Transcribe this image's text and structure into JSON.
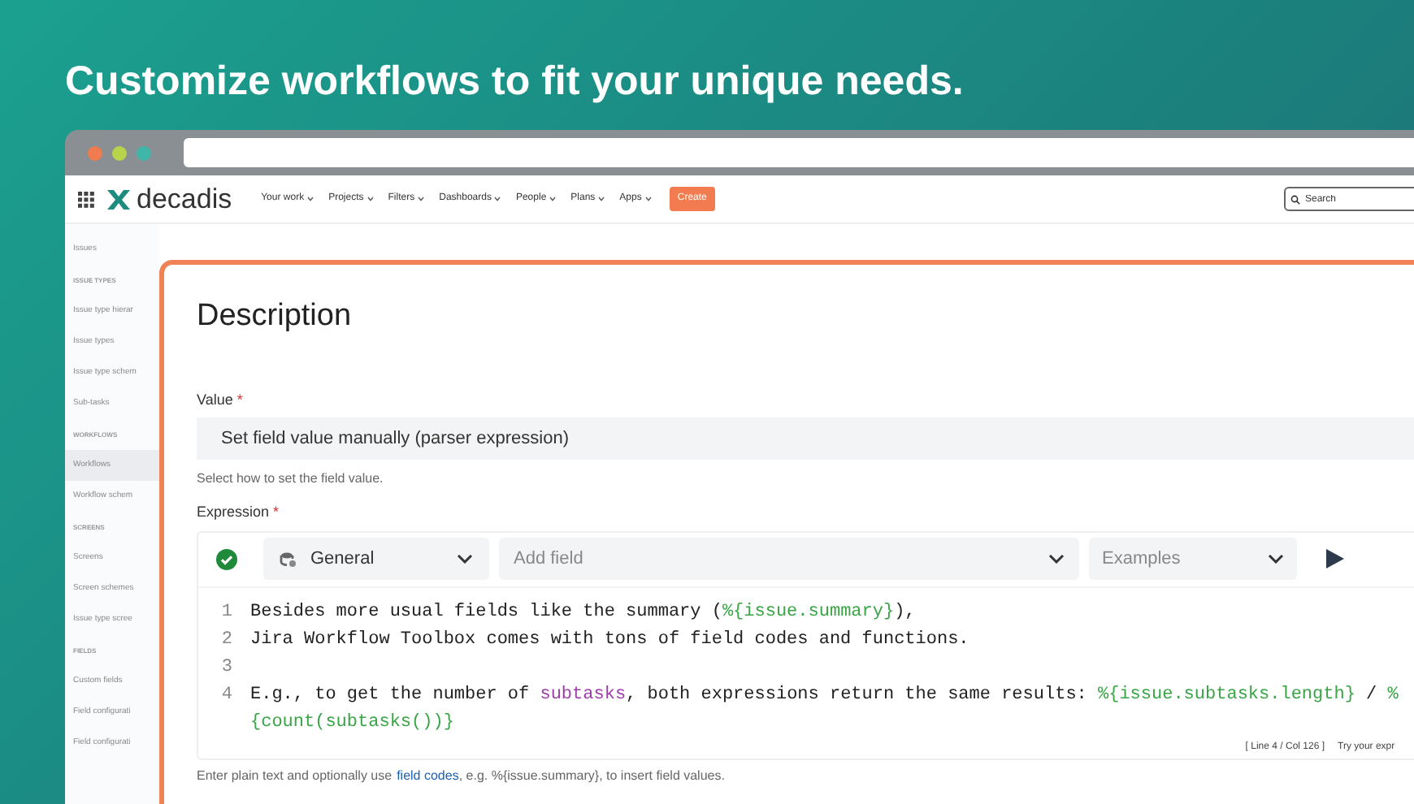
{
  "headline": "Customize workflows to fit your unique needs.",
  "nav": {
    "logo": "decadis",
    "items": [
      "Your work",
      "Projects",
      "Filters",
      "Dashboards",
      "People",
      "Plans",
      "Apps"
    ],
    "create": "Create",
    "search": {
      "placeholder": "Search"
    }
  },
  "sidebar": {
    "items": [
      {
        "label": "Issues",
        "kind": "item",
        "selected": false
      },
      {
        "label": "ISSUE TYPES",
        "kind": "heading",
        "selected": false
      },
      {
        "label": "Issue type hierar",
        "kind": "item",
        "selected": false
      },
      {
        "label": "Issue types",
        "kind": "item",
        "selected": false
      },
      {
        "label": "Issue type schem",
        "kind": "item",
        "selected": false
      },
      {
        "label": "Sub-tasks",
        "kind": "item",
        "selected": false
      },
      {
        "label": "WORKFLOWS",
        "kind": "heading",
        "selected": false
      },
      {
        "label": "Workflows",
        "kind": "item",
        "selected": true
      },
      {
        "label": "Workflow schem",
        "kind": "item",
        "selected": false
      },
      {
        "label": "SCREENS",
        "kind": "heading",
        "selected": false
      },
      {
        "label": "Screens",
        "kind": "item",
        "selected": false
      },
      {
        "label": "Screen schemes",
        "kind": "item",
        "selected": false
      },
      {
        "label": "Issue type scree",
        "kind": "item",
        "selected": false
      },
      {
        "label": "FIELDS",
        "kind": "heading",
        "selected": false
      },
      {
        "label": "Custom fields",
        "kind": "item",
        "selected": false
      },
      {
        "label": "Field configurati",
        "kind": "item",
        "selected": false
      },
      {
        "label": "Field configurati",
        "kind": "item",
        "selected": false
      }
    ]
  },
  "panel": {
    "title": "Description",
    "value": {
      "label": "Value",
      "required_mark": "*",
      "value": "Set field value manually (parser expression)",
      "help": "Select how to set the field value."
    },
    "expression": {
      "label": "Expression",
      "required_mark": "*",
      "valid": true,
      "toolbar": {
        "category": "General",
        "field": {
          "placeholder": "Add field"
        },
        "examples": "Examples"
      },
      "lines": [
        {
          "number": "1",
          "segments": [
            {
              "kind": "text",
              "text": "Besides more usual fields like the summary ("
            },
            {
              "kind": "field",
              "text": "%{issue.summary}"
            },
            {
              "kind": "text",
              "text": "),"
            }
          ]
        },
        {
          "number": "2",
          "segments": [
            {
              "kind": "text",
              "text": "Jira Workflow Toolbox comes with tons of field codes and functions."
            }
          ]
        },
        {
          "number": "3"
        },
        {
          "number": "4",
          "segments": [
            {
              "kind": "text",
              "text": "E.g., to get the number of "
            },
            {
              "kind": "function",
              "text": "subtasks"
            },
            {
              "kind": "text",
              "text": ", both expressions return the same results: "
            },
            {
              "kind": "field",
              "text": "%{issue.subtasks.length}"
            },
            {
              "kind": "text",
              "text": " / "
            },
            {
              "kind": "field",
              "text": "%{count(subtasks())}"
            }
          ]
        }
      ],
      "cursor": "[ Line 4 / Col 126 ]",
      "hint": "Try your expr",
      "help": {
        "before": "Enter plain text and optionally use",
        "link": "field codes",
        "after": ", e.g. %{issue.summary}, to insert field values."
      }
    }
  }
}
